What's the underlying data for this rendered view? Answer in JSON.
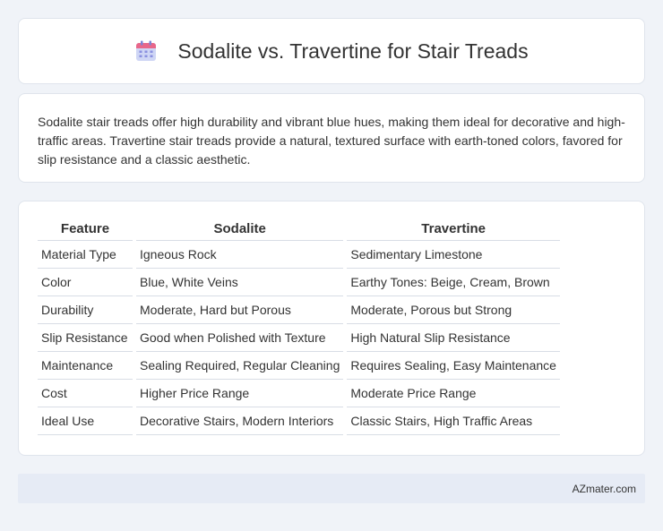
{
  "header": {
    "title": "Sodalite vs. Travertine for Stair Treads",
    "icon": "calendar-icon",
    "icon_colors": {
      "top": "#e8678a",
      "body": "#cfd6f5",
      "grid": "#8a90e0"
    }
  },
  "summary": {
    "text": "Sodalite stair treads offer high durability and vibrant blue hues, making them ideal for decorative and high-traffic areas. Travertine stair treads provide a natural, textured surface with earth-toned colors, favored for slip resistance and a classic aesthetic."
  },
  "table": {
    "headers": [
      "Feature",
      "Sodalite",
      "Travertine"
    ],
    "rows": [
      [
        "Material Type",
        "Igneous Rock",
        "Sedimentary Limestone"
      ],
      [
        "Color",
        "Blue, White Veins",
        "Earthy Tones: Beige, Cream, Brown"
      ],
      [
        "Durability",
        "Moderate, Hard but Porous",
        "Moderate, Porous but Strong"
      ],
      [
        "Slip Resistance",
        "Good when Polished with Texture",
        "High Natural Slip Resistance"
      ],
      [
        "Maintenance",
        "Sealing Required, Regular Cleaning",
        "Requires Sealing, Easy Maintenance"
      ],
      [
        "Cost",
        "Higher Price Range",
        "Moderate Price Range"
      ],
      [
        "Ideal Use",
        "Decorative Stairs, Modern Interiors",
        "Classic Stairs, High Traffic Areas"
      ]
    ]
  },
  "footer": {
    "brand": "AZmater.com"
  }
}
